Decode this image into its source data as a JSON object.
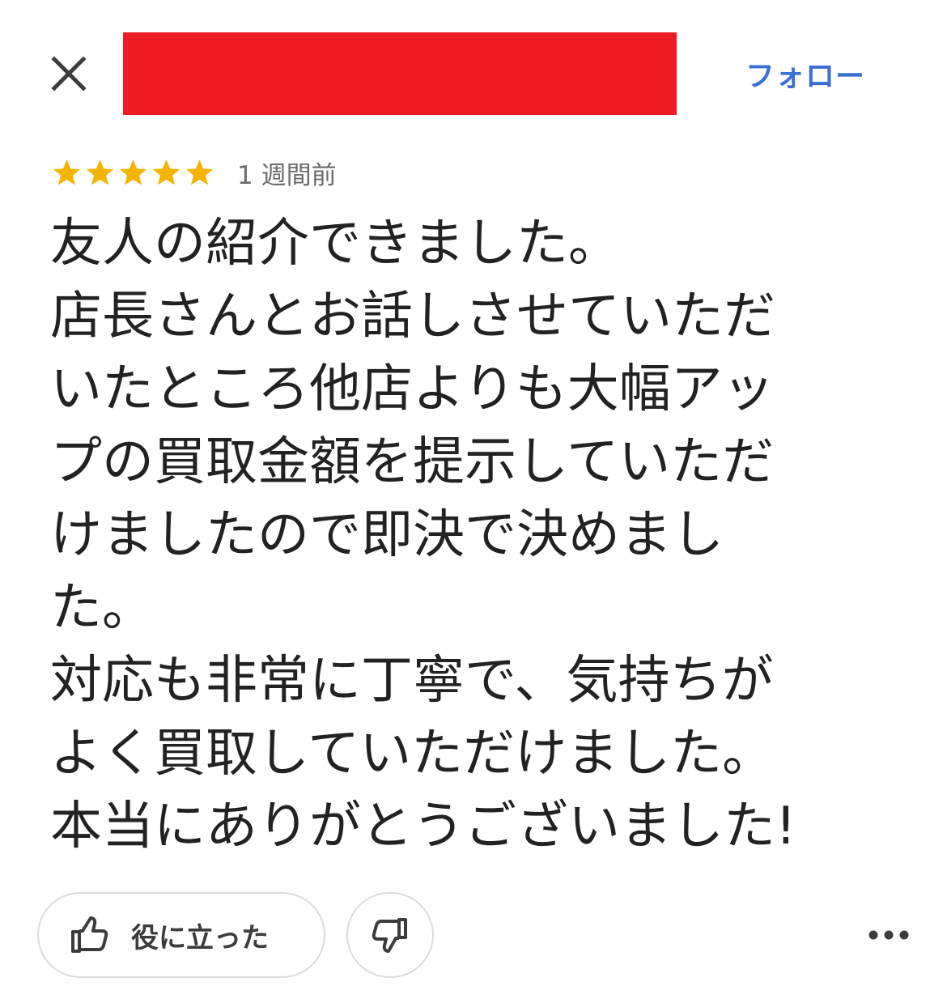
{
  "header": {
    "follow_label": "フォロー",
    "accent_color": "#3a6fd4",
    "redaction_color": "#ed1c24"
  },
  "review": {
    "rating": 5,
    "max_rating": 5,
    "star_color": "#f4b400",
    "time_ago": "1 週間前",
    "lines": [
      "友人の紹介できました。",
      "店長さんとお話しさせていただ",
      "いたところ他店よりも大幅アッ",
      "プの買取金額を提示していただ",
      "けましたので即決で決めまし",
      "た。",
      "対応も非常に丁寧で、気持ちが",
      "よく買取していただけました。",
      "本当にありがとうございました!"
    ]
  },
  "actions": {
    "helpful_label": "役に立った",
    "helpful_icon": "thumbs-up-icon",
    "dislike_icon": "thumbs-down-icon",
    "more_icon": "more-horizontal-icon",
    "close_icon": "close-icon"
  }
}
